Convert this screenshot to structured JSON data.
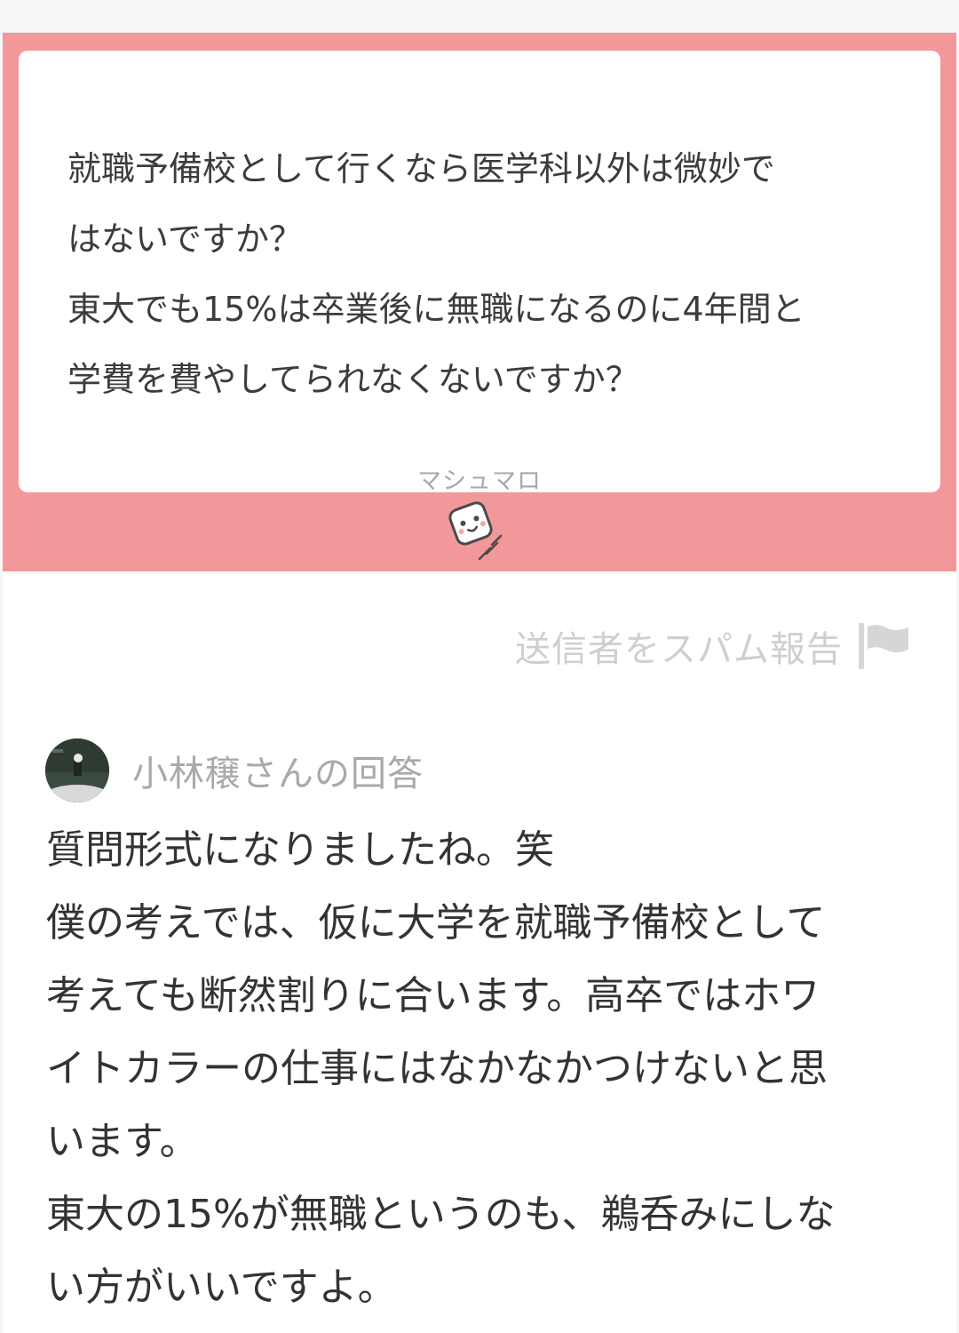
{
  "question": {
    "text": "就職予備校として行くなら医学科以外は微妙で\nはないですか？\n東大でも15%は卒業後に無職になるのに4年間と\n学費を費やしてられなくないですか？",
    "brand": "マシュマロ"
  },
  "spam_report": {
    "label": "送信者をスパム報告",
    "icon": "flag-icon"
  },
  "answer": {
    "header": "小林穣さんの回答",
    "avatar_icon": "avatar",
    "text": "質問形式になりましたね。笑\n僕の考えでは、仮に大学を就職予備校として\n考えても断然割りに合います。高卒ではホワ\nイトカラーの仕事にはなかなかつけないと思\nいます。\n東大の15%が無職というのも、鵜呑みにしな\nい方がいいですよ。"
  },
  "colors": {
    "band": "#f2989b",
    "muted_text": "#a9a9a9",
    "body_text": "#333333"
  }
}
